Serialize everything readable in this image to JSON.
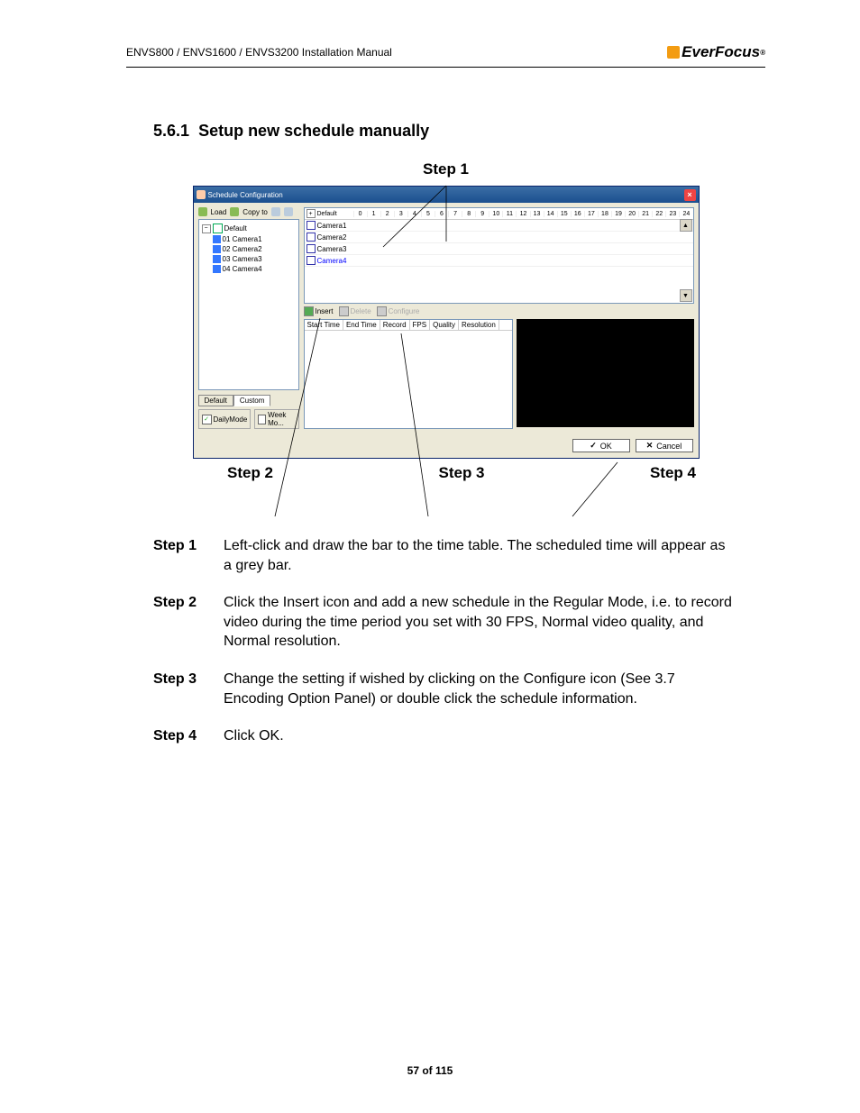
{
  "header": {
    "manual": "ENVS800 / ENVS1600 / ENVS3200 Installation Manual",
    "brand": "EverFocus"
  },
  "section": {
    "num": "5.6.1",
    "title": "Setup new schedule manually"
  },
  "stepTop": "Step 1",
  "stepsBot": [
    "Step 2",
    "Step 3",
    "Step 4"
  ],
  "dialog": {
    "title": "Schedule Configuration",
    "toolbar": {
      "load": "Load",
      "copyto": "Copy to"
    },
    "tree": {
      "root": "Default",
      "items": [
        "01 Camera1",
        "02 Camera2",
        "03 Camera3",
        "04 Camera4"
      ]
    },
    "tabs": {
      "default": "Default",
      "custom": "Custom"
    },
    "checks": {
      "daily": "DailyMode",
      "week": "Week Mo..."
    },
    "timeline": {
      "root": "Default",
      "rows": [
        "Camera1",
        "Camera2",
        "Camera3",
        "Camera4"
      ],
      "selected": 3
    },
    "midtb": {
      "insert": "Insert",
      "delete": "Delete",
      "configure": "Configure"
    },
    "grid": {
      "cols": [
        "Start Time",
        "End Time",
        "Record",
        "FPS",
        "Quality",
        "Resolution"
      ]
    },
    "buttons": {
      "ok": "OK",
      "cancel": "Cancel"
    }
  },
  "body": {
    "s1": {
      "lbl": "Step 1",
      "txt": "Left-click and draw the bar to the time table. The scheduled time will appear as a grey bar."
    },
    "s2": {
      "lbl": "Step 2",
      "txt": "Click the Insert icon and add a new schedule in the Regular Mode, i.e. to record video during the time period you set with 30 FPS, Normal video quality, and Normal resolution."
    },
    "s3": {
      "lbl": "Step 3",
      "txt": "Change the setting if wished by clicking on the Configure icon (See 3.7 Encoding Option Panel) or double click the schedule information."
    },
    "s4": {
      "lbl": "Step 4",
      "txt": "Click OK."
    }
  },
  "footer": "57 of 115",
  "hours": [
    "0",
    "1",
    "2",
    "3",
    "4",
    "5",
    "6",
    "7",
    "8",
    "9",
    "10",
    "11",
    "12",
    "13",
    "14",
    "15",
    "16",
    "17",
    "18",
    "19",
    "20",
    "21",
    "22",
    "23",
    "24"
  ]
}
